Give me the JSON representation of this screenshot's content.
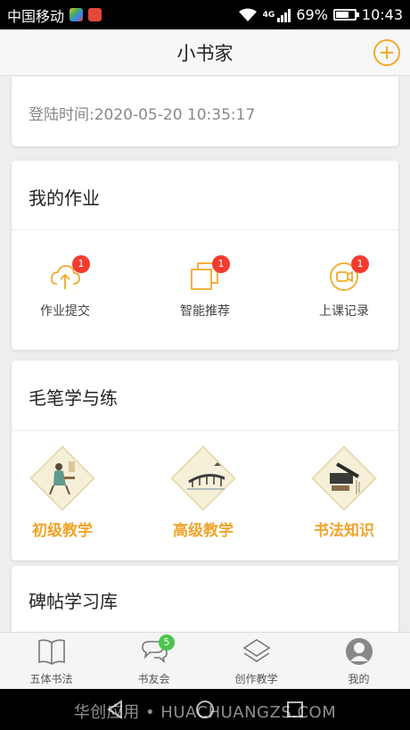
{
  "status_bar": {
    "carrier": "中国移动",
    "network": "4G",
    "battery": "69%",
    "time": "10:43",
    "battery_level": 0.69
  },
  "header": {
    "title": "小书家"
  },
  "login": {
    "text": "登陆时间:2020-05-20 10:35:17"
  },
  "homework": {
    "title": "我的作业",
    "items": [
      {
        "label": "作业提交",
        "badge": "1",
        "icon": "cloud-upload-icon"
      },
      {
        "label": "智能推荐",
        "badge": "1",
        "icon": "stacked-squares-icon"
      },
      {
        "label": "上课记录",
        "badge": "1",
        "icon": "video-record-icon"
      }
    ]
  },
  "brush": {
    "title": "毛笔学与练",
    "items": [
      {
        "label": "初级教学",
        "icon": "scholar-painting-icon"
      },
      {
        "label": "高级教学",
        "icon": "bridge-painting-icon"
      },
      {
        "label": "书法知识",
        "icon": "brush-inkstone-icon"
      }
    ]
  },
  "stele": {
    "title": "碑帖学习库"
  },
  "bottom_nav": {
    "items": [
      {
        "label": "五体书法",
        "icon": "book-icon"
      },
      {
        "label": "书友会",
        "icon": "chat-icon",
        "badge": "5"
      },
      {
        "label": "创作教学",
        "icon": "layers-icon"
      },
      {
        "label": "我的",
        "icon": "avatar-icon"
      }
    ]
  },
  "watermark": "华创应用 • HUACHUANGZS.COM",
  "colors": {
    "accent": "#f2a92b",
    "badge_red": "#f23c2e",
    "badge_green": "#4cc44c"
  }
}
